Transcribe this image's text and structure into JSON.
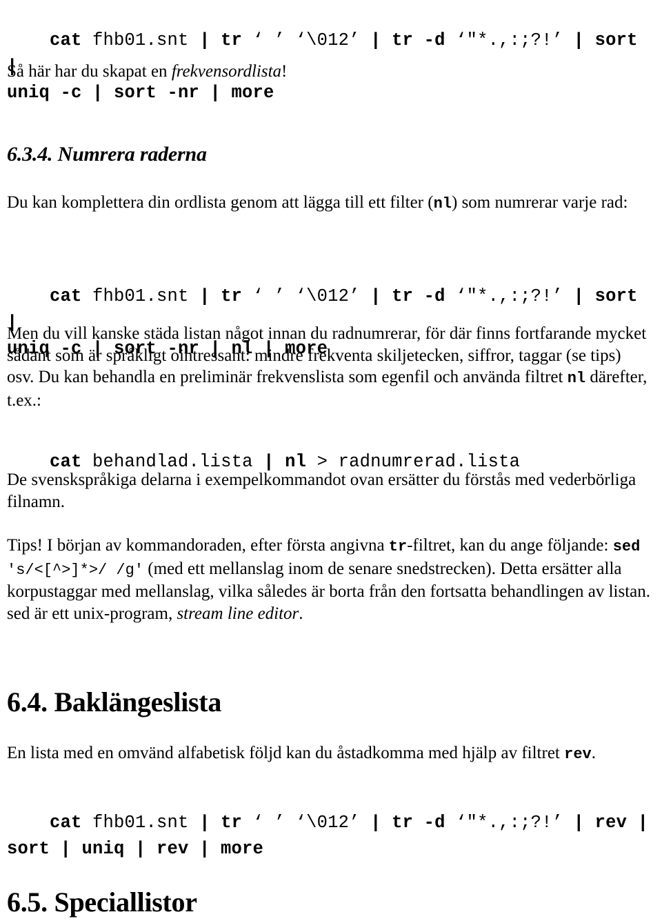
{
  "document": {
    "language": "sv",
    "sections": [
      {
        "id": "cmd-freq",
        "type": "code",
        "line1_pre": "cat",
        "line1_rest": " fhb01.snt | ",
        "text": "cat fhb01.snt | tr ‘ ’ ‘\\012’ | tr -d ‘\"*.,:;?!’ | sort | uniq -c | sort -nr | more"
      },
      {
        "id": "para-frekvensordlista",
        "type": "paragraph",
        "before": "Så här har du skapat en ",
        "italic": "frekvensordlista",
        "after": "!"
      },
      {
        "id": "heading-634",
        "type": "heading-sub",
        "text": "6.3.4. Numrera raderna"
      },
      {
        "id": "para-nl-intro",
        "type": "paragraph",
        "before": "Du kan komplettera din ordlista genom att lägga till ett filter (",
        "mono": "nl",
        "after": ") som numrerar varje rad:"
      },
      {
        "id": "cmd-freq-nl",
        "type": "code",
        "text": "cat fhb01.snt | tr ‘ ’ ‘\\012’ | tr -d ‘\"*.,:;?!’ | sort | uniq -c | sort -nr | nl | more"
      },
      {
        "id": "para-stada",
        "type": "paragraph",
        "part1": "Men du vill kanske städa listan något innan du radnumrerar, för där finns fortfarande mycket sådant som är språkligt ointressant: mindre frekventa skiljetecken, siffror, taggar (se tips) osv. Du kan behandla en preliminär frekvenslista som egenfil och använda filtret ",
        "mono": "nl",
        "part2": " därefter, t.ex.:"
      },
      {
        "id": "cmd-behandlad",
        "type": "code",
        "text": "cat behandlad.lista | nl > radnumrerad.lista"
      },
      {
        "id": "para-svensksprakiga",
        "type": "paragraph",
        "text": "De svenskspråkiga delarna i exempelkommandot ovan ersätter du förstås med vederbörliga filnamn."
      },
      {
        "id": "para-tips",
        "type": "paragraph",
        "t1": "Tips! I början av kommandoraden, efter första angivna ",
        "mono1": "tr",
        "t2": "-filtret, kan du ange följande: ",
        "mono2": "sed",
        "mono2b": " 's/<[^>]*>/ /g'",
        "t3": " (med ett mellanslag inom de senare snedstrecken). Detta ersätter alla korpustaggar med mellanslag, vilka således är borta från den fortsatta behandlingen av listan. sed är ett unix-program, ",
        "italic": "stream line editor",
        "t4": "."
      },
      {
        "id": "heading-64",
        "type": "heading-main",
        "text": "6.4. Baklängeslista"
      },
      {
        "id": "para-rev",
        "type": "paragraph",
        "before": "En lista med en omvänd alfabetisk följd kan du åstadkomma med hjälp av filtret ",
        "mono": "rev",
        "after": "."
      },
      {
        "id": "cmd-rev",
        "type": "code",
        "text": "cat fhb01.snt | tr ‘ ’ ‘\\012’ | tr -d ‘\"*.,:;?!’ | rev | sort | uniq | rev | more"
      },
      {
        "id": "heading-65",
        "type": "heading-main",
        "text": "6.5. Speciallistor"
      }
    ]
  },
  "code_lines": {
    "freq_l1_kw1": "cat",
    "freq_l1_a1": " fhb01.snt ",
    "freq_l1_k2": "| tr",
    "freq_l1_a2": " ‘ ’ ‘\\012’ ",
    "freq_l1_k3": "| tr -d",
    "freq_l1_a3": " ‘\"*.,:;?!’ ",
    "freq_l1_k4": "| sort |",
    "freq_l2": "uniq -c | sort -nr | more",
    "freqnl_l2": "uniq -c | sort -nr | nl | more",
    "behandlad_kw1": "cat",
    "behandlad_a1": " behandlad.lista ",
    "behandlad_k2": "|",
    "behandlad_a2": " ",
    "behandlad_k3": "nl",
    "behandlad_a3": " > radnumrerad.lista",
    "rev_l1_k4": "| rev |",
    "rev_l2": "sort | uniq | rev | more"
  }
}
